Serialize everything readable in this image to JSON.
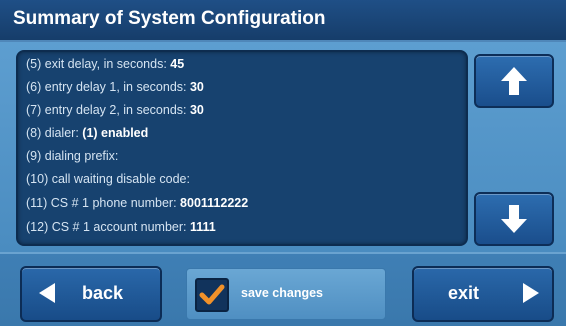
{
  "header": {
    "title": "Summary of System Configuration"
  },
  "config_items": [
    {
      "label": "(5) exit delay, in seconds:",
      "value": "45"
    },
    {
      "label": "(6) entry delay 1, in seconds:",
      "value": "30"
    },
    {
      "label": "(7) entry delay 2, in seconds:",
      "value": "30"
    },
    {
      "label": "(8) dialer:",
      "value": "(1) enabled"
    },
    {
      "label": "(9) dialing prefix:",
      "value": ""
    },
    {
      "label": "(10) call waiting disable code:",
      "value": ""
    },
    {
      "label": "(11) CS # 1 phone number:",
      "value": "8001112222"
    },
    {
      "label": "(12) CS # 1 account number:",
      "value": "1111"
    }
  ],
  "scroll": {
    "up_icon": "arrow-up-icon",
    "down_icon": "arrow-down-icon"
  },
  "footer": {
    "back_label": "back",
    "save_changes_label": "save changes",
    "save_changes_checked": true,
    "exit_label": "exit"
  },
  "colors": {
    "checkmark": "#f0912a",
    "panel": "#17426f",
    "title_bar": "#1f4f86"
  }
}
